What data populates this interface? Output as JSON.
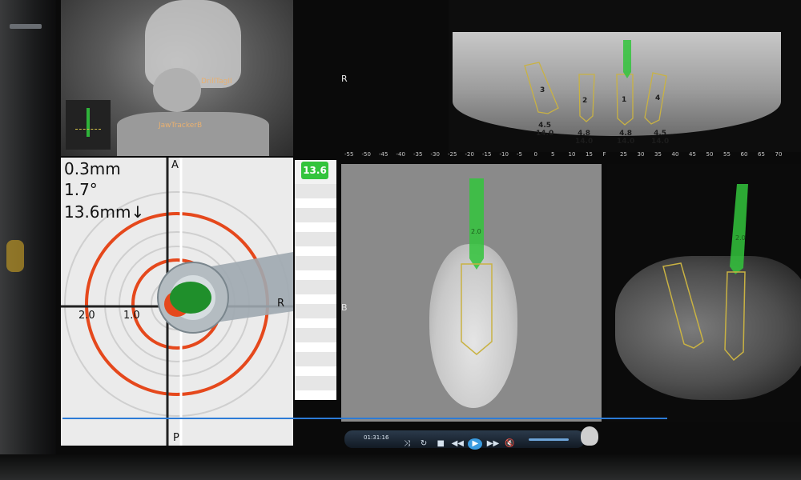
{
  "camera_view": {
    "tag_drill": "DrillTagII",
    "tag_jaw": "JawTrackerB"
  },
  "guidance": {
    "readout_offset": "0.3mm",
    "readout_angle": "1.7°",
    "readout_depth": "13.6mm↓",
    "label_a": "A",
    "label_p": "P",
    "label_r": "R",
    "ring_2": "2.0",
    "ring_1": "1.0",
    "depth_badge": "13.6"
  },
  "panorama": {
    "side_label": "R",
    "implants": [
      {
        "number": "3",
        "spec_top": "4.5",
        "spec_bottom": "14.0"
      },
      {
        "number": "2",
        "spec_top": "4.8",
        "spec_bottom": "14.0"
      },
      {
        "number": "1",
        "spec_top": "4.8",
        "spec_bottom": "14.0"
      },
      {
        "number": "4",
        "spec_top": "4.5",
        "spec_bottom": "14.0"
      }
    ]
  },
  "ruler": {
    "ticks": [
      "-55",
      "-50",
      "-45",
      "-40",
      "-35",
      "-30",
      "-25",
      "-20",
      "-15",
      "-10",
      "-5",
      "0",
      "5",
      "10",
      "15",
      "F",
      "25",
      "30",
      "35",
      "40",
      "45",
      "50",
      "55",
      "60",
      "65",
      "70"
    ]
  },
  "cross_section": {
    "side_label": "B",
    "drill_label": "2.0"
  },
  "axial_view": {
    "drill_label": "2.0"
  },
  "media_bar": {
    "time": "01:31:16",
    "controls": [
      "shuffle",
      "repeat",
      "stop",
      "rewind",
      "play",
      "fast-forward",
      "mute",
      "volume"
    ]
  },
  "colors": {
    "drill_green": "#33c43c",
    "target_red": "#e5481c",
    "implant_outline": "#c9b243",
    "timeline_blue": "#2c7bd6"
  }
}
